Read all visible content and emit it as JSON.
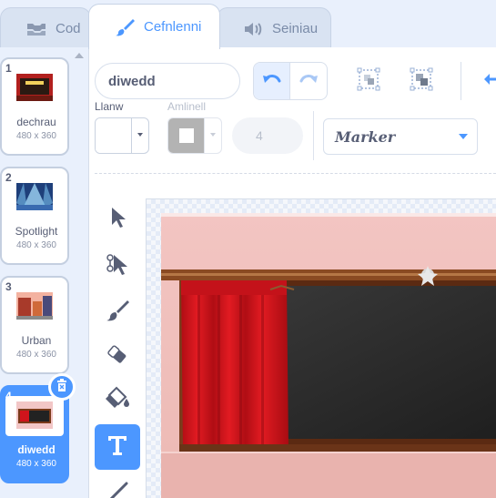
{
  "tabs": [
    {
      "label": "Cod",
      "icon": "code-icon"
    },
    {
      "label": "Cefnlenni",
      "icon": "brush-icon",
      "active": true
    },
    {
      "label": "Seiniau",
      "icon": "speaker-icon"
    }
  ],
  "costumes": [
    {
      "number": "1",
      "name": "dechrau",
      "size": "480 x 360"
    },
    {
      "number": "2",
      "name": "Spotlight",
      "size": "480 x 360"
    },
    {
      "number": "3",
      "name": "Urban",
      "size": "480 x 360"
    },
    {
      "number": "4",
      "name": "diwedd",
      "size": "480 x 360",
      "selected": true
    }
  ],
  "editor": {
    "costume_name": "diwedd",
    "fill_label": "Llanw",
    "outline_label": "Amlinell",
    "outline_width": "4",
    "font": "Marker"
  },
  "tools": [
    "select-icon",
    "reshape-icon",
    "brush-icon",
    "eraser-icon",
    "fill-icon",
    "text-icon",
    "line-icon"
  ],
  "colors": {
    "accent": "#4c97ff",
    "fill": "#ffffff",
    "outline": "#b3b3b3",
    "curtain": "#d0141c",
    "wall": "#f2c0c0"
  }
}
